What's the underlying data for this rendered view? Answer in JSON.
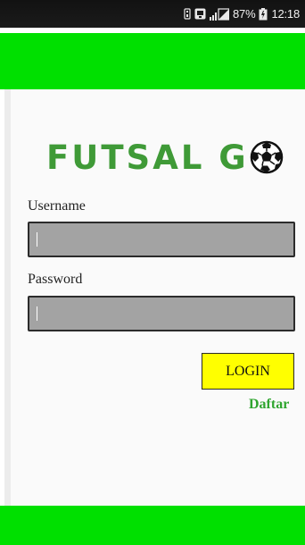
{
  "status_bar": {
    "battery_percent": "87%",
    "time": "12:18",
    "icons": [
      "sim-icon",
      "notification-icon",
      "signal-icon",
      "battery-icon"
    ]
  },
  "app": {
    "logo_text": "FUTSAL G",
    "logo_icon": "soccer-ball-icon",
    "brand_color": "#00e000",
    "logo_color": "#3f9a37"
  },
  "form": {
    "username_label": "Username",
    "username_value": "",
    "password_label": "Password",
    "password_value": "",
    "login_label": "LOGIN",
    "register_label": "Daftar"
  }
}
